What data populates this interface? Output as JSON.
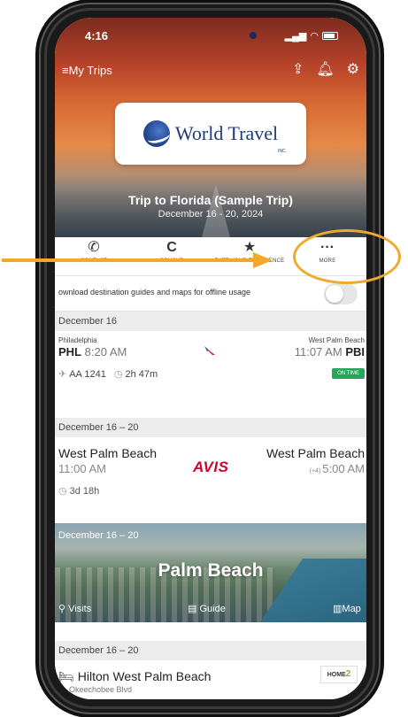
{
  "status": {
    "time": "4:16"
  },
  "topbar": {
    "my_trips": "My Trips"
  },
  "logo": {
    "text": "World Travel",
    "inc": "INC."
  },
  "trip": {
    "title": "Trip to Florida (Sample Trip)",
    "dates": "December 16 - 20, 2024"
  },
  "toolbar": [
    {
      "label": "CONTACT",
      "icon": "phone-icon"
    },
    {
      "label": "CONCUR",
      "icon": "concur-icon"
    },
    {
      "label": "RATE YOUR EXPERIENCE",
      "icon": "star-icon"
    },
    {
      "label": "MORE",
      "icon": "more-icon"
    }
  ],
  "offline": {
    "text": "ownload destination guides and maps for offline usage",
    "enabled": false
  },
  "flight": {
    "date": "December 16",
    "from_city": "Philadelphia",
    "from_code": "PHL",
    "from_time": "8:20 AM",
    "to_city": "West Palm Beach",
    "to_time": "11:07 AM",
    "to_code": "PBI",
    "flight_no": "AA 1241",
    "duration": "2h 47m",
    "status": "ON TIME"
  },
  "car": {
    "date": "December 16 – 20",
    "pickup_city": "West Palm Beach",
    "pickup_time": "11:00 AM",
    "brand": "AVIS",
    "dropoff_city": "West Palm Beach",
    "dropoff_offset": "(+4)",
    "dropoff_time": "5:00 AM",
    "duration": "3d 18h"
  },
  "destination": {
    "date": "December 16 – 20",
    "name": "Palm Beach",
    "visits": "Visits",
    "guide": "Guide",
    "map": "Map"
  },
  "hotel": {
    "date": "December 16 – 20",
    "name": "Hilton West Palm Beach",
    "address": "Okeechobee Blvd",
    "logo_text": "HOME",
    "logo_num": "2"
  },
  "annotation": {
    "color": "#f0a92a"
  }
}
